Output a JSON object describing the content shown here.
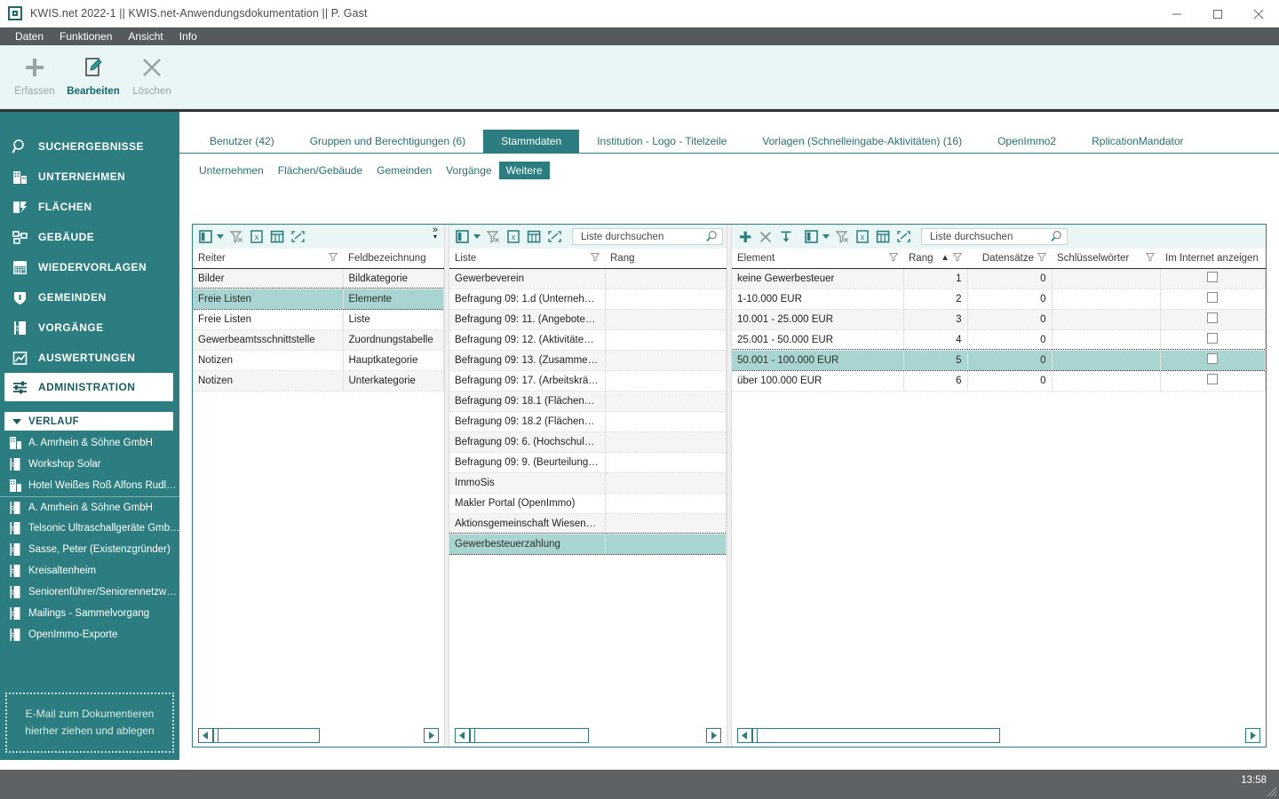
{
  "window": {
    "title": "KWIS.net 2022-1 || KWIS.net-Anwendungsdokumentation || P. Gast",
    "app_icon": "app-logo-icon",
    "minimize": "–",
    "maximize": "▢",
    "close": "✕"
  },
  "menubar": {
    "items": [
      {
        "label": "Daten"
      },
      {
        "label": "Funktionen"
      },
      {
        "label": "Ansicht"
      },
      {
        "label": "Info"
      }
    ]
  },
  "ribbon": {
    "buttons": [
      {
        "label": "Erfassen",
        "icon": "plus-icon",
        "enabled": false
      },
      {
        "label": "Bearbeiten",
        "icon": "edit-document-icon",
        "enabled": true
      },
      {
        "label": "Löschen",
        "icon": "close-x-icon",
        "enabled": false
      }
    ]
  },
  "sidebar": {
    "nav": [
      {
        "label": "SUCHERGEBNISSE",
        "icon": "magnifier-icon",
        "active": false
      },
      {
        "label": "UNTERNEHMEN",
        "icon": "building-icon",
        "active": false
      },
      {
        "label": "FLÄCHEN",
        "icon": "layers-icon",
        "active": false
      },
      {
        "label": "GEBÄUDE",
        "icon": "floorplan-icon",
        "active": false
      },
      {
        "label": "WIEDERVORLAGEN",
        "icon": "calendar-icon",
        "active": false
      },
      {
        "label": "GEMEINDEN",
        "icon": "shield-icon",
        "active": false
      },
      {
        "label": "VORGÄNGE",
        "icon": "binder-icon",
        "active": false
      },
      {
        "label": "AUSWERTUNGEN",
        "icon": "chart-icon",
        "active": false
      },
      {
        "label": "ADMINISTRATION",
        "icon": "sliders-icon",
        "active": true
      }
    ],
    "history_header": {
      "label": "VERLAUF",
      "icon": "chevron-down-icon"
    },
    "history": [
      {
        "label": "A. Amrhein & Söhne GmbH",
        "icon": "building-icon"
      },
      {
        "label": "Workshop Solar",
        "icon": "binder-icon"
      },
      {
        "label": "Hotel Weißes Roß Alfons Rudl…",
        "icon": "building-icon"
      },
      {
        "label": "A. Amrhein & Söhne GmbH",
        "icon": "binder-icon"
      },
      {
        "label": "Telsonic Ultraschallgeräte Gmb…",
        "icon": "binder-icon"
      },
      {
        "label": "Sasse, Peter (Existenzgründer)",
        "icon": "binder-icon"
      },
      {
        "label": "Kreisaltenheim",
        "icon": "binder-icon"
      },
      {
        "label": "Seniorenführer/Seniorennetzw…",
        "icon": "binder-icon"
      },
      {
        "label": "Mailings - Sammelvorgang",
        "icon": "binder-icon"
      },
      {
        "label": "OpenImmo-Exporte",
        "icon": "binder-icon"
      }
    ],
    "maildrop": {
      "line1": "E-Mail  zum Dokumentieren",
      "line2": "hierher ziehen und ablegen"
    }
  },
  "tabs": {
    "main": [
      {
        "label": "Benutzer (42)",
        "active": false
      },
      {
        "label": "Gruppen und Berechtigungen (6)",
        "active": false
      },
      {
        "label": "Stammdaten",
        "active": true
      },
      {
        "label": "Institution - Logo - Titelzeile",
        "active": false
      },
      {
        "label": "Vorlagen (Schnelleingabe-Aktivitäten) (16)",
        "active": false
      },
      {
        "label": "OpenImmo2",
        "active": false
      },
      {
        "label": "RplicationMandator",
        "active": false
      }
    ],
    "sub": [
      {
        "label": "Unternehmen",
        "active": false
      },
      {
        "label": "Flächen/Gebäude",
        "active": false
      },
      {
        "label": "Gemeinden",
        "active": false
      },
      {
        "label": "Vorgänge",
        "active": false
      },
      {
        "label": "Weitere",
        "active": true
      }
    ]
  },
  "panel1": {
    "toolbar": {
      "icons": [
        "columns-icon",
        "chevron-down-icon",
        "clear-filter-icon",
        "export-excel-icon",
        "grid-icon",
        "expand-icon"
      ],
      "more": "chevron-more-icon"
    },
    "columns": [
      {
        "label": "Reiter",
        "filter": true
      },
      {
        "label": "Feldbezeichnung",
        "filter": false
      }
    ],
    "rows": [
      {
        "reiter": "Bilder",
        "feld": "Bildkategorie",
        "selected": false
      },
      {
        "reiter": "Freie Listen",
        "feld": "Elemente",
        "selected": true
      },
      {
        "reiter": "Freie Listen",
        "feld": "Liste",
        "selected": false
      },
      {
        "reiter": "Gewerbeamtsschnittstelle",
        "feld": "Zuordnungstabelle",
        "selected": false
      },
      {
        "reiter": "Notizen",
        "feld": "Hauptkategorie",
        "selected": false
      },
      {
        "reiter": "Notizen",
        "feld": "Unterkategorie",
        "selected": false
      }
    ],
    "scroll": {
      "left_arrow": "◀",
      "right_arrow": "▶"
    }
  },
  "panel2": {
    "toolbar": {
      "icons": [
        "columns-icon",
        "chevron-down-icon",
        "clear-filter-icon",
        "export-excel-icon",
        "grid-icon",
        "expand-icon"
      ],
      "search_placeholder": "Liste durchsuchen",
      "search_value": "",
      "search_icon": "search-icon"
    },
    "columns": [
      {
        "label": "Liste",
        "filter": true
      },
      {
        "label": "Rang",
        "filter": false
      }
    ],
    "rows": [
      {
        "liste": "Gewerbeverein",
        "rang": "",
        "selected": false
      },
      {
        "liste": "Befragung 09: 1.d (Unternehm…",
        "rang": "",
        "selected": false
      },
      {
        "liste": "Befragung 09: 11. (Angebote…",
        "rang": "",
        "selected": false
      },
      {
        "liste": "Befragung 09: 12. (Aktivitäten…",
        "rang": "",
        "selected": false
      },
      {
        "liste": "Befragung 09: 13. (Zusammen…",
        "rang": "",
        "selected": false
      },
      {
        "liste": "Befragung 09: 17. (Arbeitskräft…",
        "rang": "",
        "selected": false
      },
      {
        "liste": "Befragung 09: 18.1 (Flächenü…",
        "rang": "",
        "selected": false
      },
      {
        "liste": "Befragung 09: 18.2 (Flächenb…",
        "rang": "",
        "selected": false
      },
      {
        "liste": "Befragung 09: 6. (Hochschulk…",
        "rang": "",
        "selected": false
      },
      {
        "liste": "Befragung 09: 9. (Beurteilung…",
        "rang": "",
        "selected": false
      },
      {
        "liste": "ImmoSis",
        "rang": "",
        "selected": false
      },
      {
        "liste": "Makler Portal (OpenImmo)",
        "rang": "",
        "selected": false
      },
      {
        "liste": "Aktionsgemeinschaft  Wieseng…",
        "rang": "",
        "selected": false
      },
      {
        "liste": "Gewerbesteuerzahlung",
        "rang": "",
        "selected": true
      }
    ],
    "scroll": {
      "left_arrow": "◀",
      "right_arrow": "▶"
    }
  },
  "panel3": {
    "toolbar": {
      "icons": [
        "plus-icon",
        "close-x-icon",
        "insert-row-icon",
        "columns-icon",
        "chevron-down-icon",
        "clear-filter-icon",
        "export-excel-icon",
        "grid-icon",
        "expand-icon"
      ],
      "search_placeholder": "Liste durchsuchen",
      "search_value": "",
      "search_icon": "search-icon"
    },
    "columns": [
      {
        "label": "Element",
        "filter": true,
        "align": "left",
        "sort": ""
      },
      {
        "label": "Rang",
        "filter": true,
        "align": "left",
        "sort": "▲"
      },
      {
        "label": "Datensätze",
        "filter": true,
        "align": "right",
        "sort": ""
      },
      {
        "label": "Schlüsselwörter",
        "filter": true,
        "align": "left",
        "sort": ""
      },
      {
        "label": "Im Internet anzeigen",
        "filter": false,
        "align": "left",
        "sort": ""
      }
    ],
    "rows": [
      {
        "element": "keine Gewerbesteuer",
        "rang": "1",
        "datensaetze": "0",
        "schluessel": "",
        "internet": false,
        "selected": false
      },
      {
        "element": "1-10.000 EUR",
        "rang": "2",
        "datensaetze": "0",
        "schluessel": "",
        "internet": false,
        "selected": false
      },
      {
        "element": "10.001 - 25.000 EUR",
        "rang": "3",
        "datensaetze": "0",
        "schluessel": "",
        "internet": false,
        "selected": false
      },
      {
        "element": "25.001 - 50.000 EUR",
        "rang": "4",
        "datensaetze": "0",
        "schluessel": "",
        "internet": false,
        "selected": false
      },
      {
        "element": "50.001 - 100.000 EUR",
        "rang": "5",
        "datensaetze": "0",
        "schluessel": "",
        "internet": false,
        "selected": true
      },
      {
        "element": "über 100.000 EUR",
        "rang": "6",
        "datensaetze": "0",
        "schluessel": "",
        "internet": false,
        "selected": false
      }
    ],
    "scroll": {
      "left_arrow": "◀",
      "right_arrow": "▶"
    }
  },
  "statusbar": {
    "time": "13:58"
  },
  "colors": {
    "teal": "#2b7d7f",
    "teal_dark": "#1a5c5e",
    "ribbon_bg": "#e9f6f5",
    "menu_bg": "#555a5d",
    "status_bg": "#5e6265",
    "selection": "#a8d5d2"
  }
}
